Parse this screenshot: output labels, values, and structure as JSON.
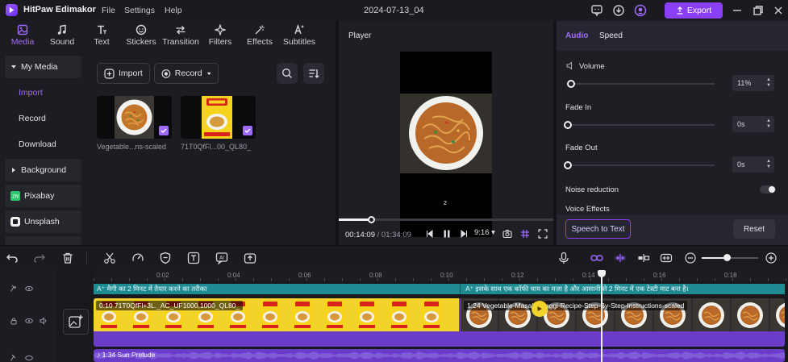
{
  "titlebar": {
    "app_name": "HitPaw Edimakor",
    "menu": [
      "File",
      "Settings",
      "Help"
    ],
    "project_title": "2024-07-13_04",
    "export_label": "Export"
  },
  "top_tabs": [
    {
      "label": "Media",
      "icon": "media-icon",
      "active": true
    },
    {
      "label": "Sound",
      "icon": "music-note-icon"
    },
    {
      "label": "Text",
      "icon": "text-icon"
    },
    {
      "label": "Stickers",
      "icon": "sticker-icon"
    },
    {
      "label": "Transition",
      "icon": "transition-icon"
    },
    {
      "label": "Filters",
      "icon": "filter-sparkle-icon"
    },
    {
      "label": "Effects",
      "icon": "effects-icon"
    },
    {
      "label": "Subtitles",
      "icon": "subtitles-icon"
    }
  ],
  "sidebar": {
    "my_media": "My Media",
    "import": "Import",
    "record": "Record",
    "download": "Download",
    "background": "Background",
    "pixabay": "Pixabay",
    "unsplash": "Unsplash"
  },
  "media": {
    "import_label": "Import",
    "record_label": "Record",
    "items": [
      {
        "caption": "Vegetable...ns-scaled"
      },
      {
        "caption": "71T0QfFl...00_QL80_"
      }
    ]
  },
  "player": {
    "label": "Player",
    "current_time": "00:14:09",
    "total_time": "01:34:09",
    "aspect": "9:16",
    "progress": 0.15,
    "frame_caption": "2"
  },
  "audio_panel": {
    "tab_audio": "Audio",
    "tab_speed": "Speed",
    "volume_label": "Volume",
    "volume_value": "11%",
    "volume_level": 0.02,
    "fade_in_label": "Fade In",
    "fade_in_value": "0s",
    "fade_out_label": "Fade Out",
    "fade_out_value": "0s",
    "noise_reduction_label": "Noise reduction",
    "noise_reduction_on": false,
    "voice_effects_label": "Voice Effects",
    "speech_to_text_label": "Speech to Text",
    "reset_label": "Reset"
  },
  "timeline": {
    "ruler_ticks": [
      "0:02",
      "0:04",
      "0:06",
      "0:08",
      "0:10",
      "0:12",
      "0:14",
      "0:16",
      "0:18"
    ],
    "subtitle_1": "मैगी का 2 मिनट में तैयार करने का तरीका",
    "subtitle_2": "इसके साथ एक कॉफी चाय का मज़ा है और आसानी से 2 मिनट में एक टेस्टी माट बना है।",
    "clip_1_label": "0:10 71T0QfFl+3L._AC_UF1000,1000_QL80_",
    "clip_2_label": "1:24 Vegetable-Masala-Maggi-Recipe-Step-By-Step-Instructions-scaled",
    "audio_label": "1:34 Sun Prelude"
  },
  "colors": {
    "accent": "#8b3ff5",
    "accent_light": "#a06bff",
    "subtitle_track": "#1e8a92",
    "video_track": "#6a3cc8",
    "clip_yellow": "#f2d32b"
  }
}
